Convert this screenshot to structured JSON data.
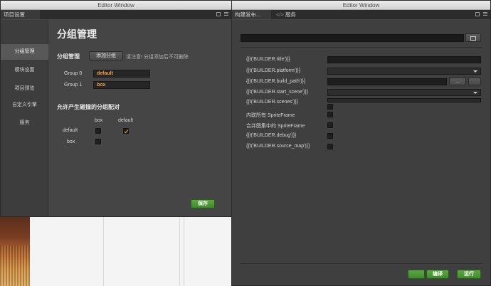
{
  "left_window": {
    "title": "Editor Window",
    "tab_label": "项目设置",
    "sidebar": {
      "items": [
        {
          "label": "分组管理",
          "active": true
        },
        {
          "label": "模块设置",
          "active": false
        },
        {
          "label": "项目预览",
          "active": false
        },
        {
          "label": "自定义引擎",
          "active": false
        },
        {
          "label": "服务",
          "active": false
        }
      ]
    },
    "main": {
      "page_title": "分组管理",
      "group_section_label": "分组管理",
      "add_group_button": "添加分组",
      "add_group_note": "请注意! 分组添加后不可删除",
      "groups": [
        {
          "label": "Group 0",
          "value": "default"
        },
        {
          "label": "Group 1",
          "value": "box"
        }
      ],
      "collision_title": "允许产生碰撞的分组配对",
      "matrix": {
        "column_headers": [
          "box",
          "default"
        ],
        "row_headers": [
          "default",
          "box"
        ],
        "checked": [
          [
            false,
            true
          ],
          [
            false
          ]
        ]
      },
      "save_button": "保存"
    }
  },
  "right_window": {
    "title": "Editor Window",
    "tabs": [
      {
        "label": "构建发布...",
        "active": true
      },
      {
        "label": "服务",
        "active": false
      }
    ],
    "fields": [
      {
        "label": "{{t('BUILDER.title')}}",
        "type": "input"
      },
      {
        "label": "{{t('BUILDER.platform')}}",
        "type": "select"
      },
      {
        "label": "{{t('BUILDER.build_path')}}",
        "type": "path",
        "browse_label": "..."
      },
      {
        "label": "{{t('BUILDER.start_scene')}}",
        "type": "select"
      },
      {
        "label": "{{t('BUILDER.scenes')}}",
        "type": "checkbox-list"
      },
      {
        "label": "内联所有 SpriteFrame",
        "type": "checkbox"
      },
      {
        "label": "合并图集中的 SpriteFrame",
        "type": "checkbox"
      },
      {
        "label": "{{t('BUILDER.debug')}}",
        "type": "checkbox"
      },
      {
        "label": "{{t('BUILDER.source_map')}}",
        "type": "checkbox"
      }
    ],
    "footer": {
      "build_label": "",
      "compile_label": "编译",
      "run_label": "运行"
    }
  },
  "colors": {
    "accent_orange": "#f0a040",
    "button_green": "#4f9a37",
    "panel_bg": "#454545",
    "sidebar_active": "#585858"
  },
  "icons": [
    "window-restore-icon",
    "menu-icon",
    "folder-icon",
    "arrow-icon",
    "checkmark-icon"
  ]
}
